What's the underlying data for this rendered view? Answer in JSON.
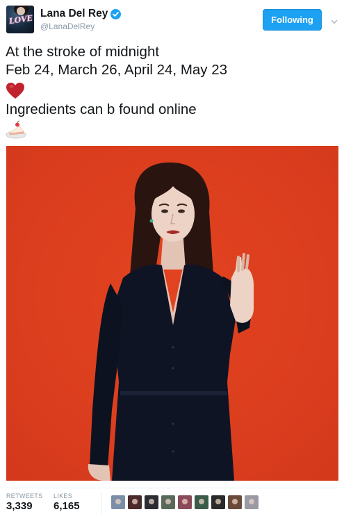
{
  "header": {
    "display_name": "Lana Del Rey",
    "handle": "@LanaDelRey",
    "avatar_text": "LOVE",
    "follow_label": "Following",
    "verified_icon": "verified-badge-icon",
    "menu_icon": "chevron-down-icon"
  },
  "tweet": {
    "line1": "At the stroke of midnight",
    "line2": "Feb 24, March 26, April 24, May 23",
    "emoji1": "heart-icon",
    "line3": "Ingredients can b found online",
    "emoji2": "cake-icon",
    "photo_icon": "portrait-photo"
  },
  "stats": {
    "retweets_label": "RETWEETS",
    "retweets_value": "3,339",
    "likes_label": "LIKES",
    "likes_value": "6,165",
    "liker_count_shown": 9
  },
  "colors": {
    "accent": "#1da1f2",
    "text": "#14171a",
    "muted": "#8899a6",
    "photo_background": "#e0401e",
    "heart": "#c1232e"
  }
}
